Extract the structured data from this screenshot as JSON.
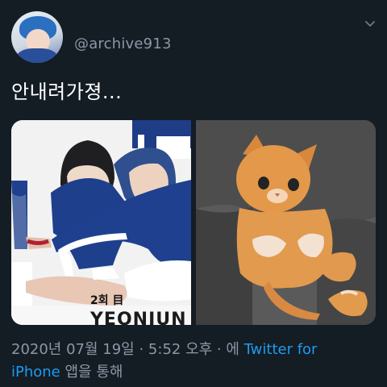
{
  "header": {
    "handle": "@archive913",
    "avatar_icon": "profile-avatar"
  },
  "tweet": {
    "text": "안내려가졍..."
  },
  "media": {
    "left_caption_small": "2회 目",
    "left_caption_big": "YEONJUN",
    "left_description": "",
    "right_description": ""
  },
  "footer": {
    "date": "2020년 07월 19일",
    "sep": " · ",
    "time": "5:52 오후",
    "sep2": " · ",
    "via_prefix": "에 ",
    "via_link_1": "Twitter for",
    "via_link_2": "iPhone",
    "via_suffix": " 앱을 통해"
  }
}
